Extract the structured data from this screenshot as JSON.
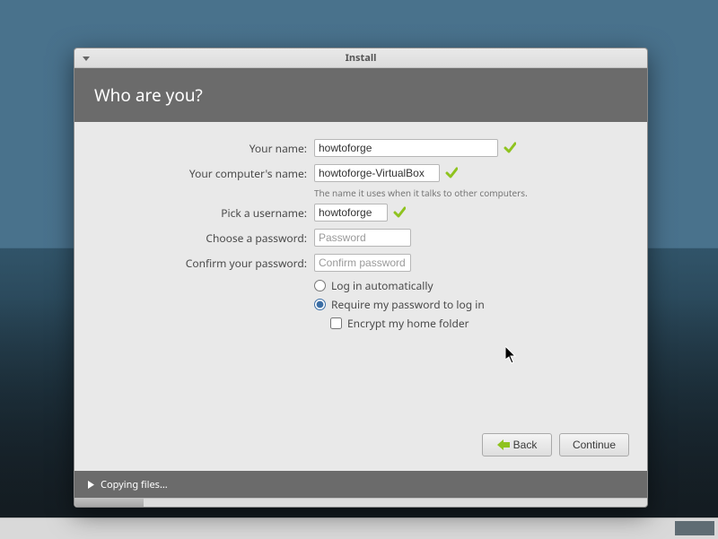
{
  "window": {
    "title": "Install"
  },
  "header": {
    "title": "Who are you?"
  },
  "labels": {
    "name": "Your name:",
    "computer": "Your computer's name:",
    "computer_hint": "The name it uses when it talks to other computers.",
    "username": "Pick a username:",
    "password": "Choose a password:",
    "confirm": "Confirm your password:"
  },
  "fields": {
    "name": "howtoforge",
    "computer": "howtoforge-VirtualBox",
    "username": "howtoforge",
    "password_placeholder": "Password",
    "confirm_placeholder": "Confirm password"
  },
  "options": {
    "login_auto": "Log in automatically",
    "login_pwd": "Require my password to log in",
    "encrypt": "Encrypt my home folder"
  },
  "buttons": {
    "back": "Back",
    "continue": "Continue"
  },
  "status": {
    "text": "Copying files…",
    "progress_percent": 12
  },
  "icons": {
    "check": "check-icon",
    "back_arrow": "arrow-left-icon",
    "expand": "triangle-right-icon",
    "minimize": "minimize-icon",
    "cursor": "cursor-icon"
  }
}
